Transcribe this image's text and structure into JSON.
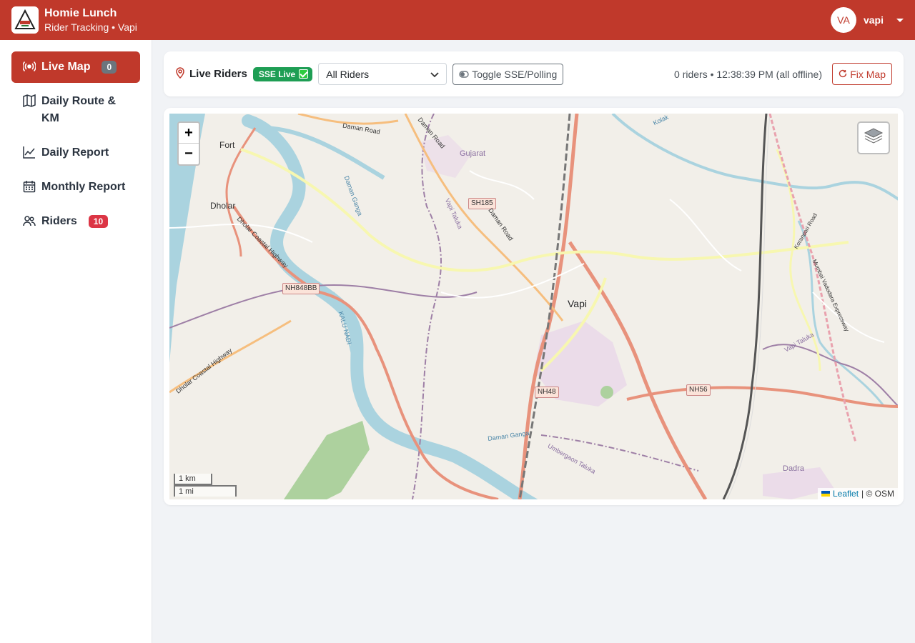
{
  "header": {
    "app_title": "Homie Lunch",
    "subtitle": "Rider Tracking • Vapi",
    "logo_icon": "homie-lunch-logo",
    "avatar_initials": "VA",
    "user_name": "vapi"
  },
  "sidebar": {
    "items": [
      {
        "label": "Live Map",
        "icon": "broadcast-icon",
        "badge": "0",
        "active": true
      },
      {
        "label": "Daily Route & KM",
        "icon": "map-icon"
      },
      {
        "label": "Daily Report",
        "icon": "chart-line-icon"
      },
      {
        "label": "Monthly Report",
        "icon": "calendar-icon"
      },
      {
        "label": "Riders",
        "icon": "people-icon",
        "badge": "10"
      }
    ]
  },
  "toolbar": {
    "title": "Live Riders",
    "sse_badge": "SSE Live",
    "rider_filter_value": "All Riders",
    "toggle_label": "Toggle SSE/Polling",
    "status": "0 riders • 12:38:39 PM (all offline)",
    "fix_label": "Fix Map"
  },
  "map": {
    "zoom_in": "+",
    "zoom_out": "−",
    "scale_km": "1 km",
    "scale_mi": "1 mi",
    "attribution_link": "Leaflet",
    "attribution_rest": "| © OSM",
    "places": {
      "vapi": "Vapi",
      "fort": "Fort",
      "dholar": "Dholar",
      "gujarat": "Gujarat",
      "dadra": "Dadra"
    },
    "roads": {
      "sh185": "SH185",
      "nh848bb": "NH848BB",
      "nh48": "NH48",
      "nh56": "NH56",
      "daman_road_1": "Daman Road",
      "daman_road_2": "Daman Road",
      "daman_road_3": "Daman Road",
      "dholar_coastal_1": "Dholar Coastal Highway",
      "dholar_coastal_2": "Dholar Coastal Highway",
      "vapi_taluka_1": "Vapi Taluka",
      "vapi_taluka_2": "Vapi Taluka",
      "umbergaon_taluka": "Umbergaon Taluka",
      "daman_ganga_1": "Daman Ganga",
      "daman_ganga_2": "Daman Ganga",
      "kalu_nadi": "KALU NADI",
      "koranpari_road": "Koranpari Road",
      "expressway": "Mumbai Vadodara Expressway",
      "kolak": "Kolak"
    }
  }
}
